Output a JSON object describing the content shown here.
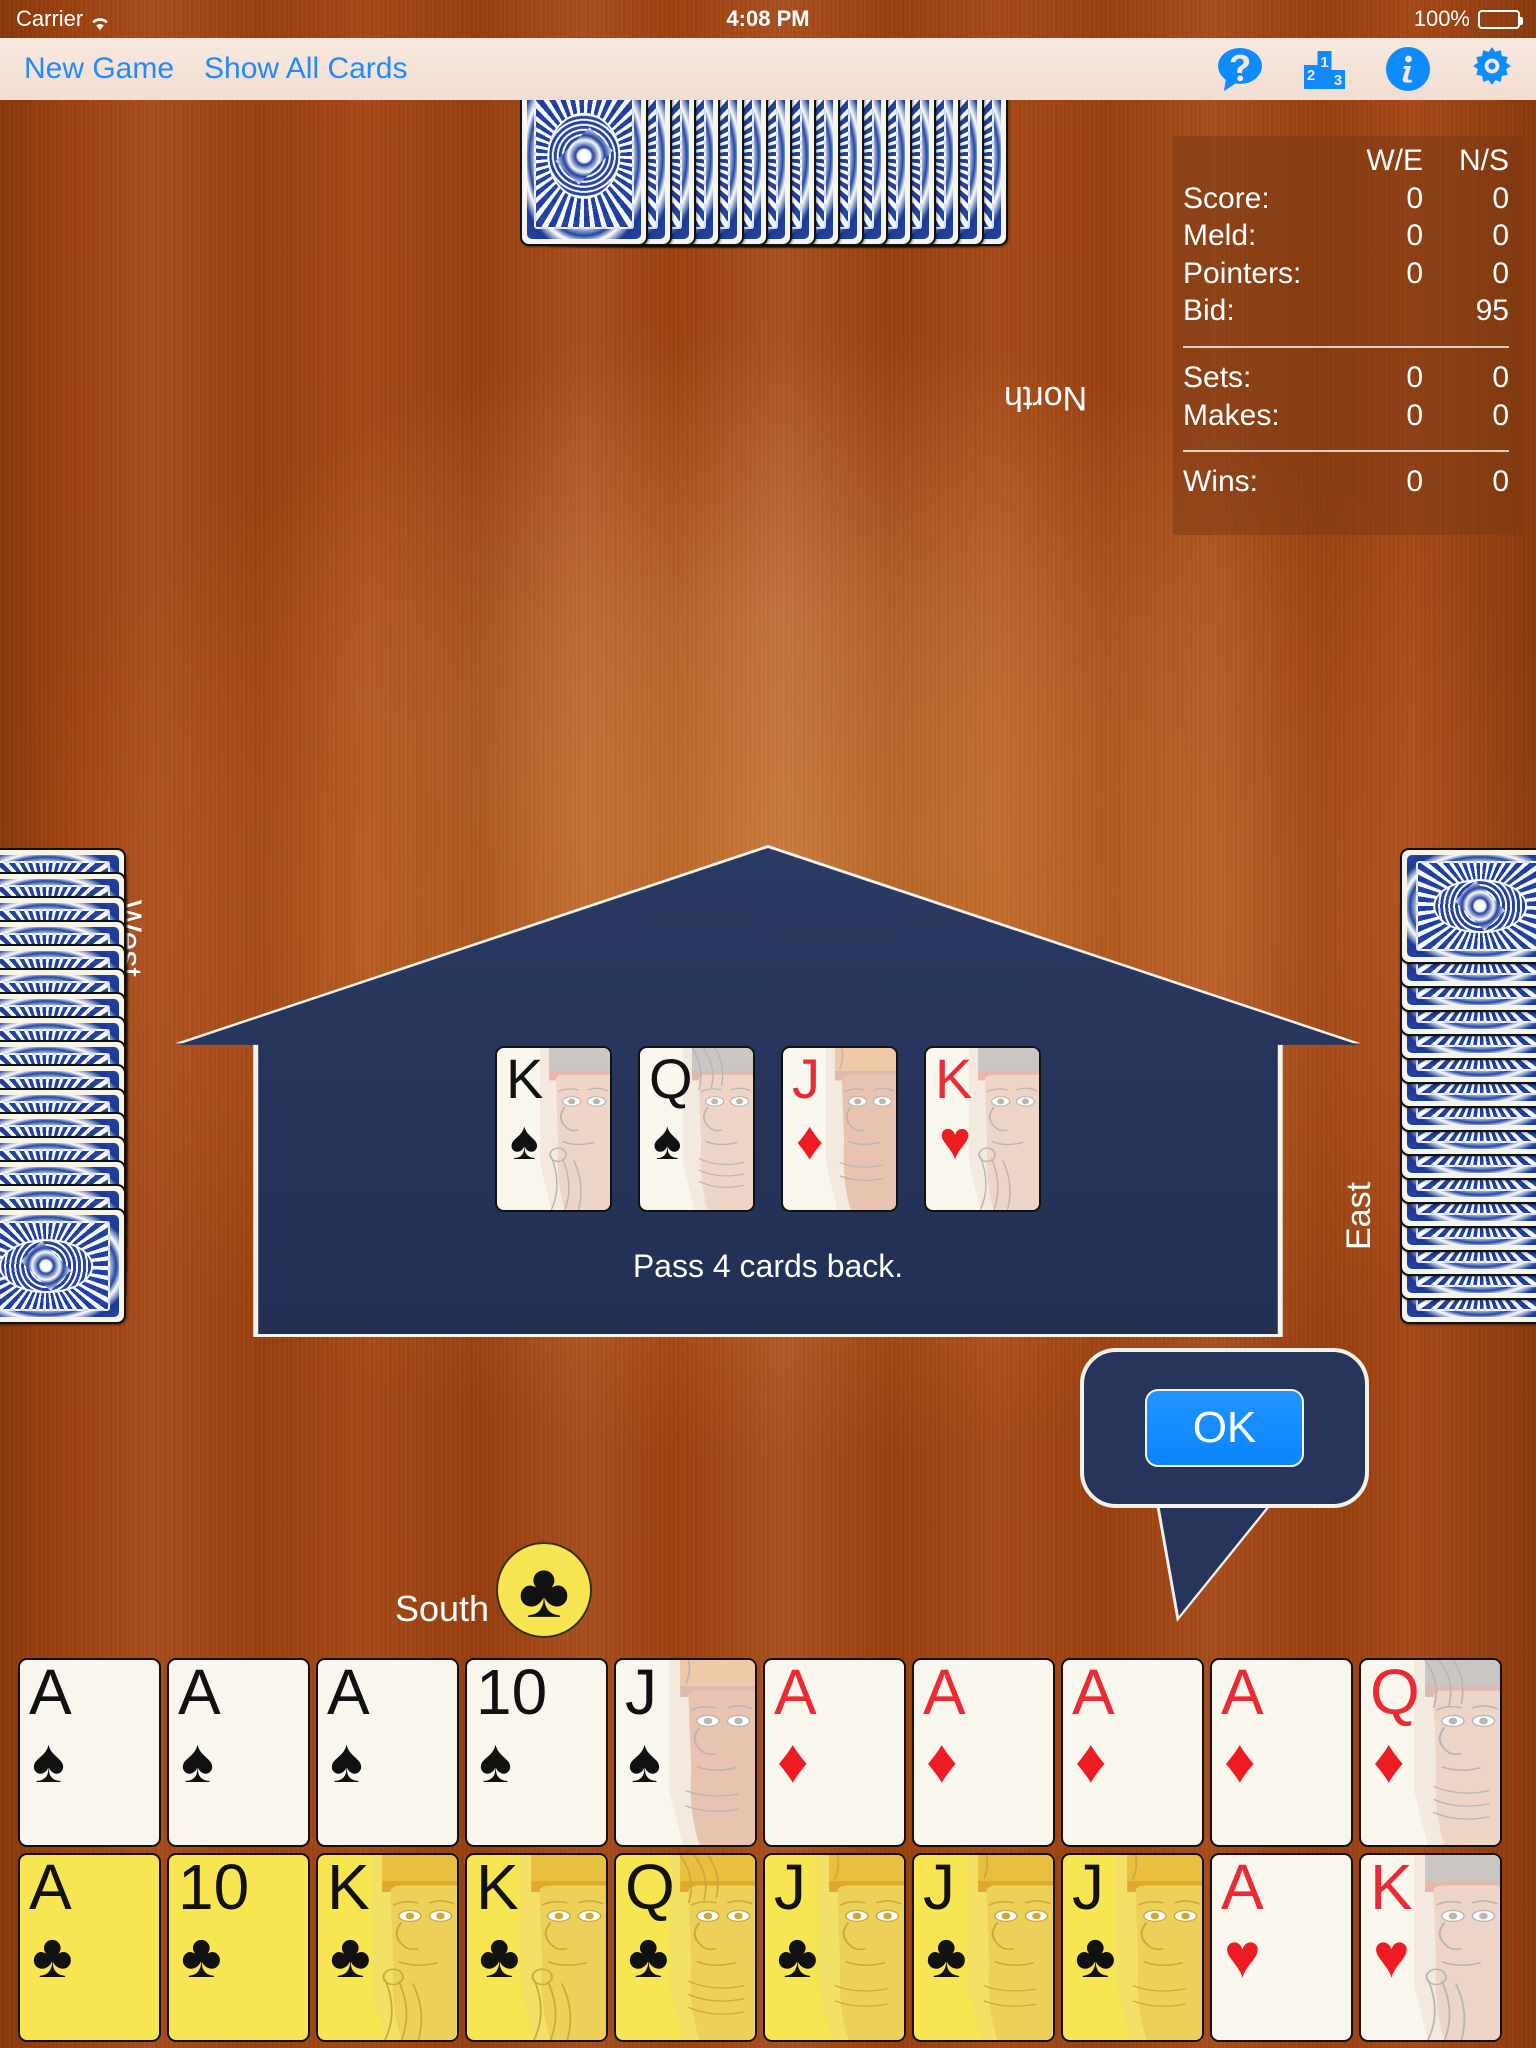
{
  "status_bar": {
    "carrier": "Carrier",
    "wifi_icon": "wifi-icon",
    "time": "4:08 PM",
    "battery_percent": "100%",
    "battery_icon": "battery-full-icon"
  },
  "toolbar": {
    "new_game_label": "New Game",
    "show_all_cards_label": "Show All Cards",
    "icons": [
      {
        "name": "help-icon",
        "title": "Help"
      },
      {
        "name": "leaderboard-icon",
        "title": "Scores"
      },
      {
        "name": "info-icon",
        "title": "Info"
      },
      {
        "name": "settings-gear-icon",
        "title": "Settings"
      }
    ],
    "accent_color": "#1f8bff"
  },
  "scoreboard": {
    "columns": [
      "",
      "W/E",
      "N/S"
    ],
    "rows": [
      {
        "label": "Score:",
        "we": "0",
        "ns": "0"
      },
      {
        "label": "Meld:",
        "we": "0",
        "ns": "0"
      },
      {
        "label": "Pointers:",
        "we": "0",
        "ns": "0"
      },
      {
        "label": "Bid:",
        "we": "",
        "ns": "95"
      }
    ],
    "rows2": [
      {
        "label": "Sets:",
        "we": "0",
        "ns": "0"
      },
      {
        "label": "Makes:",
        "we": "0",
        "ns": "0"
      }
    ],
    "rows3": [
      {
        "label": "Wins:",
        "we": "0",
        "ns": "0"
      }
    ]
  },
  "players": {
    "north": {
      "label": "North",
      "card_count": 16,
      "face_down": true
    },
    "west": {
      "label": "West",
      "card_count": 16,
      "face_down": true
    },
    "east": {
      "label": "East",
      "card_count": 16,
      "face_down": true
    },
    "south": {
      "label": "South",
      "trump_suit": "clubs",
      "trump_symbol": "♣"
    }
  },
  "dialog": {
    "message": "Pass 4 cards back.",
    "background_color": "#27355c",
    "cards": [
      {
        "rank": "K",
        "suit": "♠",
        "color": "black",
        "court": "king"
      },
      {
        "rank": "Q",
        "suit": "♠",
        "color": "black",
        "court": "queen"
      },
      {
        "rank": "J",
        "suit": "♦",
        "color": "red",
        "court": "jack"
      },
      {
        "rank": "K",
        "suit": "♥",
        "color": "red",
        "court": "king"
      }
    ]
  },
  "ok_bubble": {
    "label": "OK"
  },
  "south_hand": {
    "row1": [
      {
        "rank": "A",
        "suit": "♠",
        "color": "black",
        "court": "",
        "highlight": false
      },
      {
        "rank": "A",
        "suit": "♠",
        "color": "black",
        "court": "",
        "highlight": false
      },
      {
        "rank": "A",
        "suit": "♠",
        "color": "black",
        "court": "",
        "highlight": false
      },
      {
        "rank": "10",
        "suit": "♠",
        "color": "black",
        "court": "",
        "highlight": false
      },
      {
        "rank": "J",
        "suit": "♠",
        "color": "black",
        "court": "jack",
        "highlight": false
      },
      {
        "rank": "A",
        "suit": "♦",
        "color": "red",
        "court": "",
        "highlight": false
      },
      {
        "rank": "A",
        "suit": "♦",
        "color": "red",
        "court": "",
        "highlight": false
      },
      {
        "rank": "A",
        "suit": "♦",
        "color": "red",
        "court": "",
        "highlight": false
      },
      {
        "rank": "A",
        "suit": "♦",
        "color": "red",
        "court": "",
        "highlight": false
      },
      {
        "rank": "Q",
        "suit": "♦",
        "color": "red",
        "court": "queen",
        "highlight": false
      }
    ],
    "row2": [
      {
        "rank": "A",
        "suit": "♣",
        "color": "black",
        "court": "",
        "highlight": true
      },
      {
        "rank": "10",
        "suit": "♣",
        "color": "black",
        "court": "",
        "highlight": true
      },
      {
        "rank": "K",
        "suit": "♣",
        "color": "black",
        "court": "king",
        "highlight": true
      },
      {
        "rank": "K",
        "suit": "♣",
        "color": "black",
        "court": "king",
        "highlight": true
      },
      {
        "rank": "Q",
        "suit": "♣",
        "color": "black",
        "court": "queen",
        "highlight": true
      },
      {
        "rank": "J",
        "suit": "♣",
        "color": "black",
        "court": "jack",
        "highlight": true
      },
      {
        "rank": "J",
        "suit": "♣",
        "color": "black",
        "court": "jack",
        "highlight": true
      },
      {
        "rank": "J",
        "suit": "♣",
        "color": "black",
        "court": "jack",
        "highlight": true
      },
      {
        "rank": "A",
        "suit": "♥",
        "color": "red",
        "court": "",
        "highlight": false
      },
      {
        "rank": "K",
        "suit": "♥",
        "color": "red",
        "court": "king",
        "highlight": false
      }
    ]
  }
}
